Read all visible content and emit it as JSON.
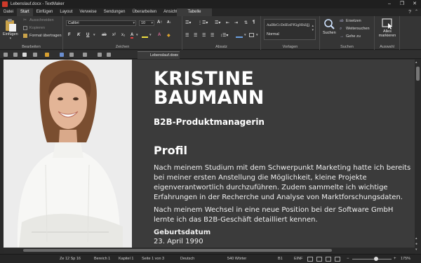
{
  "window": {
    "title": "Lebenslauf.docx - TextMaker"
  },
  "tabs": [
    "Datei",
    "Start",
    "Einfügen",
    "Layout",
    "Verweise",
    "Sendungen",
    "Überarbeiten",
    "Ansicht"
  ],
  "active_tab": "Start",
  "contextual_tab": "Tabelle",
  "ribbon": {
    "bearbeiten": {
      "label": "Bearbeiten",
      "paste": "Einfügen",
      "cut": "Ausschneiden",
      "copy": "Kopieren",
      "format_painter": "Format übertragen"
    },
    "zeichen": {
      "label": "Zeichen",
      "font": "Calibri",
      "size": "10",
      "bold": "F",
      "italic": "K",
      "underline": "U",
      "strike": "ab",
      "superscript": "x²",
      "subscript": "x₂",
      "font_color": "A",
      "clear": "A"
    },
    "absatz": {
      "label": "Absatz"
    },
    "vorlagen": {
      "label": "Vorlagen",
      "preview": "AaBbCcDdEeFfGgHhIiJj",
      "style": "Normal"
    },
    "suchen": {
      "label": "Suchen",
      "search": "Suchen",
      "replace": "Ersetzen",
      "find_next": "Weitersuchen",
      "goto": "Gehe zu"
    },
    "auswahl": {
      "label": "Auswahl",
      "select_all": "Alles markieren"
    }
  },
  "document_tab": "Lebenslauf.docx",
  "document": {
    "name_line1": "KRISTINE",
    "name_line2": "BAUMANN",
    "job_title": "B2B-Produktmanagerin",
    "section_heading": "Profil",
    "paragraph1": "Nach meinem Studium mit dem Schwerpunkt Marketing hatte ich bereits bei meiner ersten Anstellung die Möglichkeit, kleine Projekte eigenverantwortlich durchzuführen. Zudem sammelte ich wichtige Erfahrungen in der Recherche und Analyse von Marktforschungsdaten.",
    "paragraph2": "Nach meinem Wechsel in eine neue Position bei der Software GmbH lernte ich das B2B-Geschäft detailliert kennen.",
    "birth_label": "Geburtsdatum",
    "birth_value": "23. April 1990"
  },
  "statusbar": {
    "position": "Ze 12 Sp 16",
    "area": "Bereich 1",
    "chapter": "Kapitel 1",
    "page": "Seite 1 von 3",
    "language": "Deutsch",
    "words": "540 Wörter",
    "cell": "B1",
    "mode": "EINF",
    "zoom": "175%"
  },
  "colors": {
    "accent": "#d8a030",
    "background": "#2b2b2b",
    "page": "#3b3b3b"
  }
}
